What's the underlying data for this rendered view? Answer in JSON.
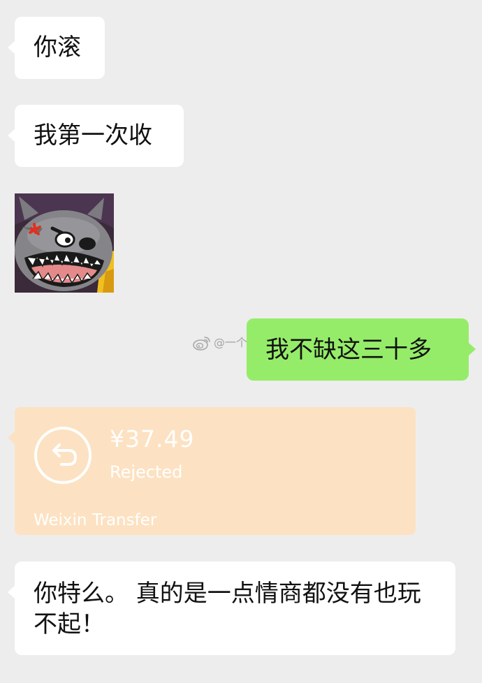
{
  "messages": {
    "m1": "你滚",
    "m2": "我第一次收",
    "m3": "我不缺这三十多",
    "m4": "你特么。 真的是一点情商都没有也玩不起！"
  },
  "sticker": {
    "icon": "angry-wolf-sticker"
  },
  "watermark": {
    "icon": "weibo-icon",
    "text": "@一个帽子"
  },
  "transfer": {
    "amount": "¥37.49",
    "status": "Rejected",
    "footer": "Weixin Transfer",
    "icon": "return-arrow-icon"
  },
  "colors": {
    "background": "#ededed",
    "incoming_bubble": "#ffffff",
    "outgoing_bubble": "#95ec69",
    "transfer_card": "#fce2c2"
  }
}
